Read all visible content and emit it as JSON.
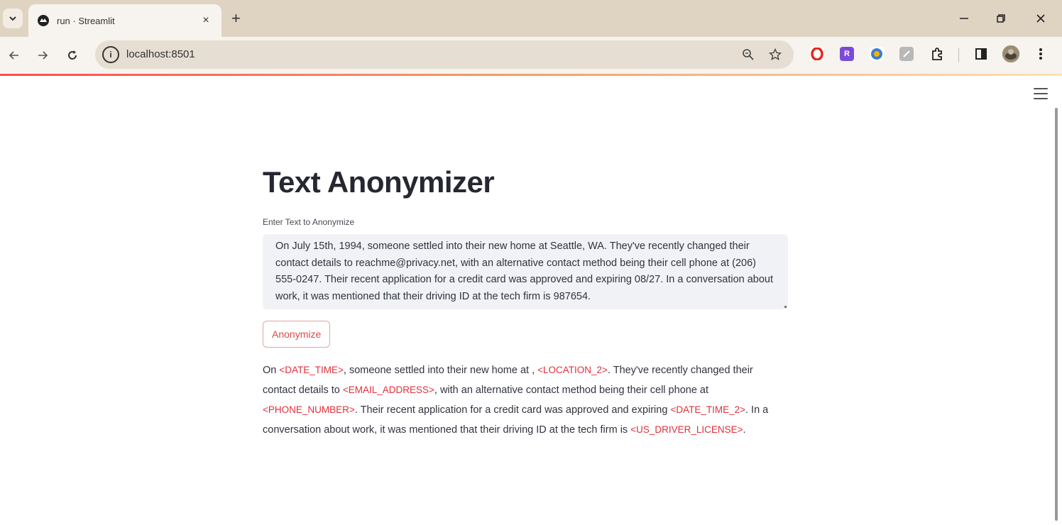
{
  "browser": {
    "tab_title": "run · Streamlit",
    "tab_close": "×",
    "new_tab": "+",
    "url": "localhost:8501",
    "extensions": [
      {
        "icon": "opera-icon",
        "color": "#e8271f",
        "label": ""
      },
      {
        "icon": "readwise-icon",
        "color": "#7b4bd8",
        "label": "R"
      },
      {
        "icon": "circle-ext-icon",
        "color": "#3b7dd8",
        "label": ""
      },
      {
        "icon": "note-ext-icon",
        "color": "#b0b0b0",
        "label": ""
      }
    ]
  },
  "app": {
    "title": "Text Anonymizer",
    "input_label": "Enter Text to Anonymize",
    "input_value": "On July 15th, 1994, someone settled into their new home at  Seattle, WA. They've recently changed their contact details to reachme@privacy.net, with an alternative contact method being their cell phone at (206) 555-0247. Their recent application for a credit card was approved and expiring 08/27. In a conversation about work, it was mentioned that their driving ID at the tech firm is 987654.",
    "button_label": "Anonymize",
    "result": [
      {
        "text": "On ",
        "tag": false
      },
      {
        "text": "<DATE_TIME>",
        "tag": true
      },
      {
        "text": ", someone settled into their new home at , ",
        "tag": false
      },
      {
        "text": "<LOCATION_2>",
        "tag": true
      },
      {
        "text": ". They've recently changed their contact details to ",
        "tag": false
      },
      {
        "text": "<EMAIL_ADDRESS>",
        "tag": true
      },
      {
        "text": ", with an alternative contact method being their cell phone at ",
        "tag": false
      },
      {
        "text": "<PHONE_NUMBER>",
        "tag": true
      },
      {
        "text": ". Their recent application for a credit card was approved and expiring ",
        "tag": false
      },
      {
        "text": "<DATE_TIME_2>",
        "tag": true
      },
      {
        "text": ". In a conversation about work, it was mentioned that their driving ID at the tech firm is ",
        "tag": false
      },
      {
        "text": "<US_DRIVER_LICENSE>",
        "tag": true
      },
      {
        "text": ".",
        "tag": false
      }
    ]
  }
}
